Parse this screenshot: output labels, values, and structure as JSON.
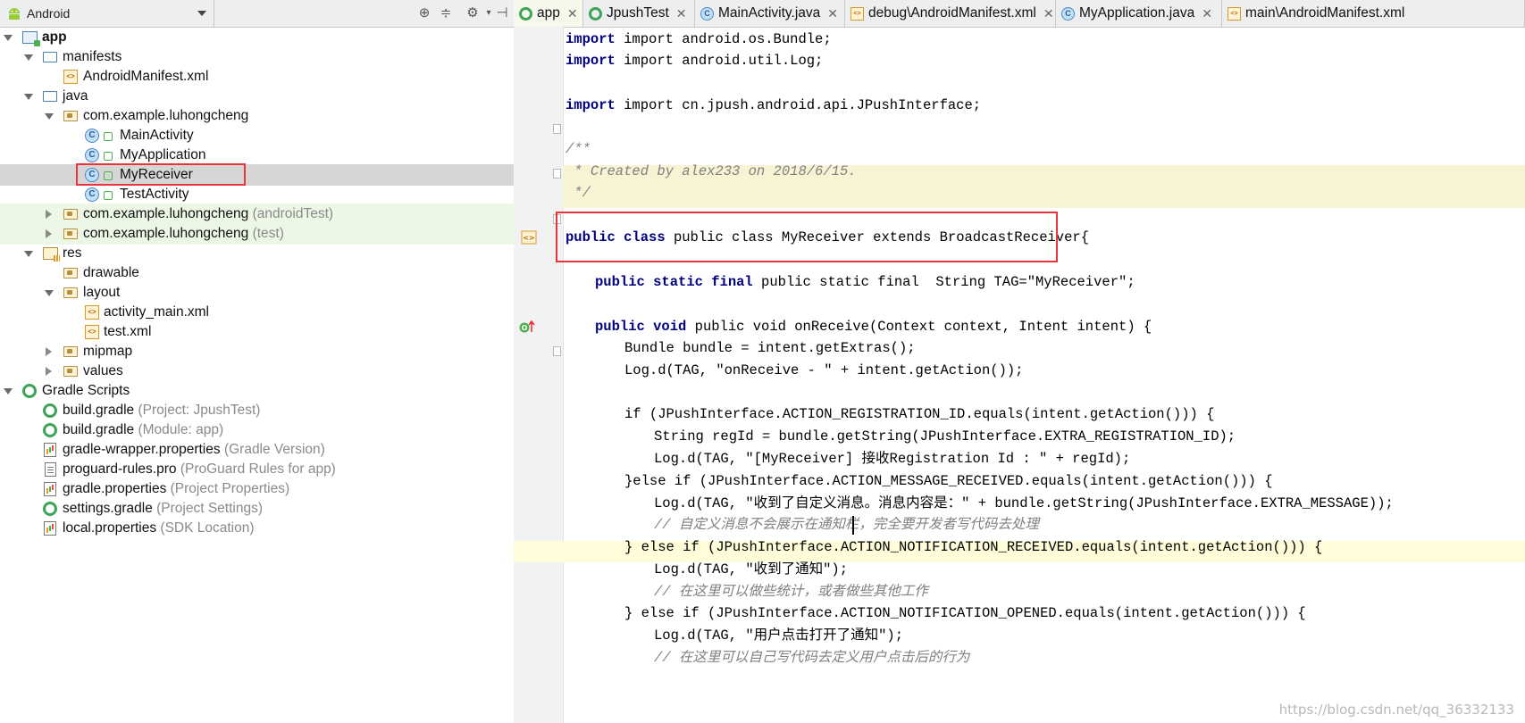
{
  "project_panel": {
    "view_selector": "Android",
    "toolbar_icons": [
      "target-icon",
      "collapse-icon",
      "gear-icon",
      "hide-panel-icon"
    ]
  },
  "tree": [
    {
      "label": "app",
      "sub": "",
      "icon": "module-folder-icon",
      "bold": true
    },
    {
      "label": "manifests",
      "sub": "",
      "icon": "folder-icon"
    },
    {
      "label": "AndroidManifest.xml",
      "sub": "",
      "icon": "xml-file-icon"
    },
    {
      "label": "java",
      "sub": "",
      "icon": "folder-icon"
    },
    {
      "label": "com.example.luhongcheng",
      "sub": "",
      "icon": "package-icon"
    },
    {
      "label": "MainActivity",
      "sub": "",
      "icon": "class-icon"
    },
    {
      "label": "MyApplication",
      "sub": "",
      "icon": "class-icon"
    },
    {
      "label": "MyReceiver",
      "sub": "",
      "icon": "class-icon"
    },
    {
      "label": "TestActivity",
      "sub": "",
      "icon": "class-icon"
    },
    {
      "label": "com.example.luhongcheng",
      "sub": "(androidTest)",
      "icon": "package-icon"
    },
    {
      "label": "com.example.luhongcheng",
      "sub": "(test)",
      "icon": "package-icon"
    },
    {
      "label": "res",
      "sub": "",
      "icon": "res-folder-icon"
    },
    {
      "label": "drawable",
      "sub": "",
      "icon": "package-icon"
    },
    {
      "label": "layout",
      "sub": "",
      "icon": "package-icon"
    },
    {
      "label": "activity_main.xml",
      "sub": "",
      "icon": "xml-file-icon"
    },
    {
      "label": "test.xml",
      "sub": "",
      "icon": "xml-file-icon"
    },
    {
      "label": "mipmap",
      "sub": "",
      "icon": "package-icon"
    },
    {
      "label": "values",
      "sub": "",
      "icon": "package-icon"
    },
    {
      "label": "Gradle Scripts",
      "sub": "",
      "icon": "gradle-icon"
    },
    {
      "label": "build.gradle",
      "sub": "(Project: JpushTest)",
      "icon": "gradle-icon"
    },
    {
      "label": "build.gradle",
      "sub": "(Module: app)",
      "icon": "gradle-icon"
    },
    {
      "label": "gradle-wrapper.properties",
      "sub": "(Gradle Version)",
      "icon": "properties-icon"
    },
    {
      "label": "proguard-rules.pro",
      "sub": "(ProGuard Rules for app)",
      "icon": "text-file-icon"
    },
    {
      "label": "gradle.properties",
      "sub": "(Project Properties)",
      "icon": "properties-icon"
    },
    {
      "label": "settings.gradle",
      "sub": "(Project Settings)",
      "icon": "gradle-icon"
    },
    {
      "label": "local.properties",
      "sub": "(SDK Location)",
      "icon": "properties-icon"
    }
  ],
  "tabs": [
    {
      "label": "app",
      "icon": "gradle-icon"
    },
    {
      "label": "JpushTest",
      "icon": "gradle-icon"
    },
    {
      "label": "MainActivity.java",
      "icon": "class-icon"
    },
    {
      "label": "debug\\AndroidManifest.xml",
      "icon": "xml-file-icon"
    },
    {
      "label": "MyApplication.java",
      "icon": "class-icon"
    },
    {
      "label": "main\\AndroidManifest.xml",
      "icon": "xml-file-icon"
    }
  ],
  "code": {
    "l1": "import android.os.Bundle;",
    "l2": "import android.util.Log;",
    "l3": "import cn.jpush.android.api.JPushInterface;",
    "l4": "/**",
    "l5": " * Created by alex233 on 2018/6/15.",
    "l6": " */",
    "l7": "public class MyReceiver extends BroadcastReceiver{",
    "l8": "public static final  String TAG=\"MyReceiver\";",
    "l9": "public void onReceive(Context context, Intent intent) {",
    "l10": "Bundle bundle = intent.getExtras();",
    "l11": "Log.d(TAG, \"onReceive - \" + intent.getAction());",
    "l12": "if (JPushInterface.ACTION_REGISTRATION_ID.equals(intent.getAction())) {",
    "l13": "String regId = bundle.getString(JPushInterface.EXTRA_REGISTRATION_ID);",
    "l14": "Log.d(TAG, \"[MyReceiver] 接收Registration Id : \" + regId);",
    "l15": "}else if (JPushInterface.ACTION_MESSAGE_RECEIVED.equals(intent.getAction())) {",
    "l16": "Log.d(TAG, \"收到了自定义消息。消息内容是：\" + bundle.getString(JPushInterface.EXTRA_MESSAGE));",
    "l17": "// 自定义消息不会展示在通知栏，完全要开发者写代码去处理",
    "l18": "} else if (JPushInterface.ACTION_NOTIFICATION_RECEIVED.equals(intent.getAction())) {",
    "l19": "Log.d(TAG, \"收到了通知\");",
    "l20": "// 在这里可以做些统计，或者做些其他工作",
    "l21": "} else if (JPushInterface.ACTION_NOTIFICATION_OPENED.equals(intent.getAction())) {",
    "l22": "Log.d(TAG, \"用户点击打开了通知\");",
    "l23": "// 在这里可以自己写代码去定义用户点击后的行为"
  },
  "watermark": "https://blog.csdn.net/qq_36332133",
  "colors": {
    "keyword": "#000080",
    "string": "#008000",
    "field": "#660e7a",
    "comment": "#808080",
    "highlight_box": "#e8343c"
  }
}
